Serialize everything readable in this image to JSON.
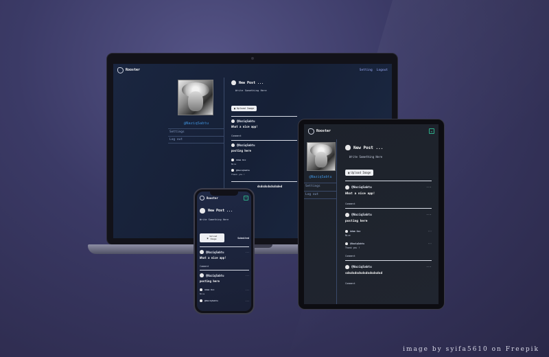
{
  "app": {
    "name": "Rooster",
    "nav": [
      "Setting",
      "Logout"
    ],
    "username": "@NaziqSabtu",
    "sidebar_menu": [
      "Settings",
      "Log out"
    ],
    "new_post_title": "New Post ...",
    "write_placeholder": "Write Something Here",
    "upload_label": "Upload Image",
    "upload_label_phone": [
      "Upload",
      "Image"
    ],
    "submit_label": "Submited",
    "comment_label": "Comment",
    "posts": [
      {
        "author": "@NaziqSabtu",
        "time": "· ·",
        "message": "What a nice app!"
      },
      {
        "author": "@NaziqSabtu",
        "time": "· ·",
        "message": "posting here",
        "comments": [
          {
            "author": "Adam Ozz",
            "text": "Nice"
          },
          {
            "author": "@NaziqSabtu",
            "text": "Thank you !"
          }
        ]
      },
      {
        "author": "@NaziqSabtu",
        "time": "· ·",
        "message": "sdsdsdsdsdsdsdsdsdsd"
      }
    ],
    "laptop_partial_message": "dsdsdsdsdsdsded"
  },
  "credit": "image by syifa5610 on Freepik",
  "colors": {
    "accent_link": "#3f8fd8",
    "nav_link": "#9fb0ff",
    "menu_icon": "#2fb08a"
  },
  "icons": [
    "rooster-logo-icon",
    "menu-icon",
    "image-upload-icon",
    "more-dots-icon",
    "user-avatar-icon"
  ]
}
